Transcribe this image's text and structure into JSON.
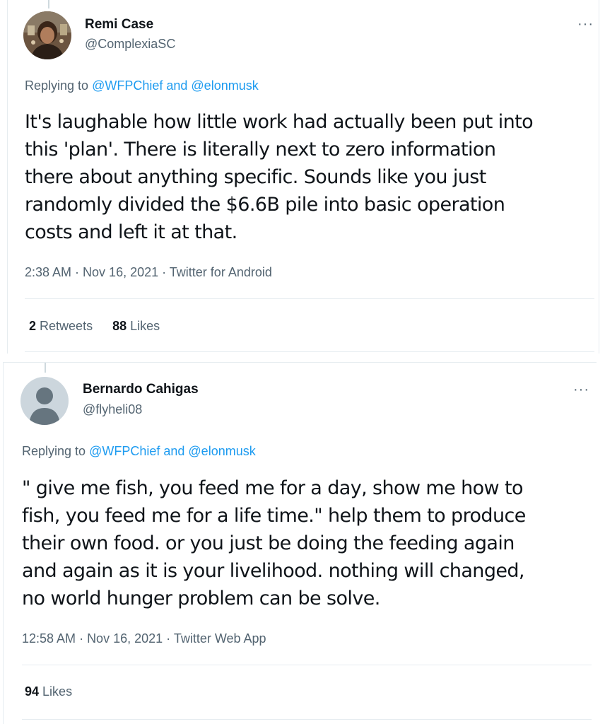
{
  "tweets": [
    {
      "author": {
        "name": "Remi Case",
        "handle": "@ComplexiaSC"
      },
      "more_icon": "more-dots-icon",
      "replying": {
        "prefix": "Replying to ",
        "mention1": "@WFPChief",
        "conjunction": " and ",
        "mention2": "@elonmusk"
      },
      "text_lines": [
        "It's laughable how little work had actually been put into",
        "this 'plan'. There is literally next to zero information",
        "there about anything specific. Sounds like you just",
        "randomly divided the $6.6B pile into basic operation",
        "costs and left it at that."
      ],
      "timestamp": "2:38 AM",
      "separator": " · ",
      "date": "Nov 16, 2021",
      "source": "Twitter for Android",
      "stats": {
        "retweets_count": "2",
        "retweets_label": "Retweets",
        "likes_count": "88",
        "likes_label": "Likes"
      }
    },
    {
      "author": {
        "name": "Bernardo Cahigas",
        "handle": "@flyheli08"
      },
      "more_icon": "more-dots-icon",
      "replying": {
        "prefix": "Replying to ",
        "mention1": "@WFPChief",
        "conjunction": " and ",
        "mention2": "@elonmusk"
      },
      "text_lines": [
        "\" give me fish, you feed me for a day, show me how to",
        "fish, you feed me for a life time.\" help them to produce",
        "their own food. or you just be doing the feeding again",
        "and again as it is your livelihood. nothing will changed,",
        "no world hunger problem can be solve."
      ],
      "timestamp": "12:58 AM",
      "separator": " · ",
      "date": "Nov 16, 2021",
      "source": "Twitter Web App",
      "stats": {
        "likes_count": "94",
        "likes_label": "Likes"
      }
    }
  ],
  "colors": {
    "link": "#1d9bf0",
    "muted": "#536471",
    "text": "#0f1419",
    "divider": "#e6ecf0"
  }
}
